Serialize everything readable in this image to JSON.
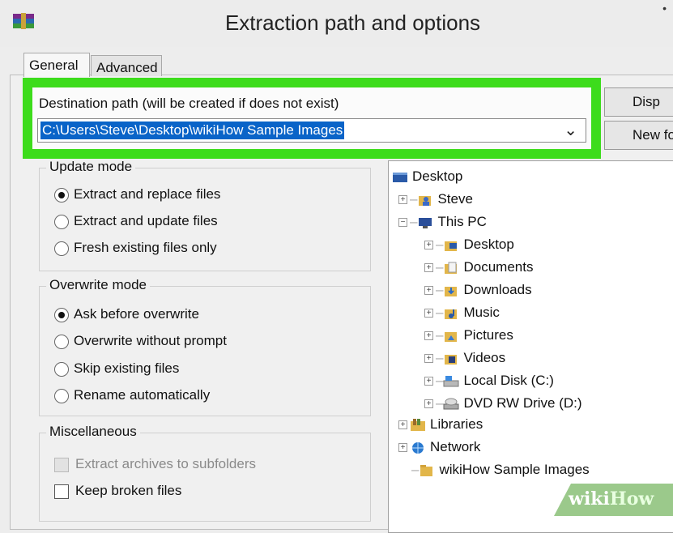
{
  "window": {
    "title": "Extraction path and options"
  },
  "tabs": [
    {
      "label": "General",
      "active": true
    },
    {
      "label": "Advanced",
      "active": false
    }
  ],
  "destination": {
    "label": "Destination path (will be created if does not exist)",
    "value": "C:\\Users\\Steve\\Desktop\\wikiHow Sample Images"
  },
  "buttons": {
    "display": "Disp",
    "new_folder": "New fo"
  },
  "update_mode": {
    "title": "Update mode",
    "options": [
      "Extract and replace files",
      "Extract and update files",
      "Fresh existing files only"
    ],
    "selected": 0
  },
  "overwrite_mode": {
    "title": "Overwrite mode",
    "options": [
      "Ask before overwrite",
      "Overwrite without prompt",
      "Skip existing files",
      "Rename automatically"
    ],
    "selected": 0
  },
  "misc": {
    "title": "Miscellaneous",
    "options": [
      {
        "label": "Extract archives to subfolders",
        "checked": false,
        "enabled": false
      },
      {
        "label": "Keep broken files",
        "checked": false,
        "enabled": true
      }
    ]
  },
  "tree": {
    "items": [
      {
        "label": "Desktop",
        "icon": "desktop-icon"
      },
      {
        "label": "Steve",
        "icon": "user-folder-icon"
      },
      {
        "label": "This PC",
        "icon": "computer-icon"
      },
      {
        "label": "Desktop",
        "icon": "desktop-folder-icon"
      },
      {
        "label": "Documents",
        "icon": "documents-folder-icon"
      },
      {
        "label": "Downloads",
        "icon": "downloads-folder-icon"
      },
      {
        "label": "Music",
        "icon": "music-folder-icon"
      },
      {
        "label": "Pictures",
        "icon": "pictures-folder-icon"
      },
      {
        "label": "Videos",
        "icon": "videos-folder-icon"
      },
      {
        "label": "Local Disk (C:)",
        "icon": "local-disk-icon"
      },
      {
        "label": "DVD RW Drive (D:)",
        "icon": "dvd-drive-icon"
      },
      {
        "label": "Libraries",
        "icon": "libraries-icon"
      },
      {
        "label": "Network",
        "icon": "network-icon"
      },
      {
        "label": "wikiHow Sample Images",
        "icon": "folder-icon"
      }
    ]
  },
  "watermark": {
    "wiki": "wiki",
    "how": "How"
  },
  "colors": {
    "highlight": "#3ddc1c",
    "selection": "#0a64c8"
  }
}
